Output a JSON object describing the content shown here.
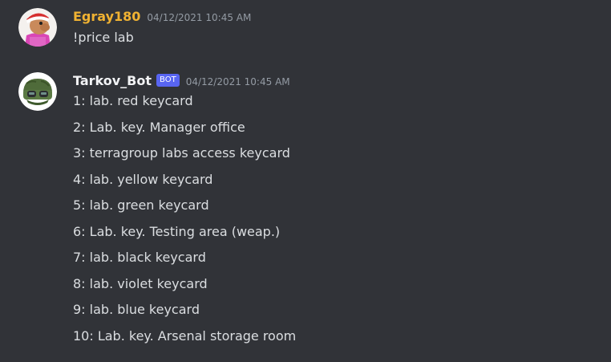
{
  "messages": [
    {
      "username": "Egray180",
      "timestamp": "04/12/2021 10:45 AM",
      "text": "!price lab",
      "avatar_icon": "cartoon-user-avatar-icon",
      "username_color": "#f0b232"
    },
    {
      "username": "Tarkov_Bot",
      "badge": "BOT",
      "timestamp": "04/12/2021 10:45 AM",
      "avatar_icon": "soldier-helmet-avatar-icon",
      "badge_color": "#5865f2",
      "lines": [
        "1: lab. red keycard",
        "2: Lab. key. Manager office",
        "3: terragroup labs access keycard",
        "4: lab. yellow keycard",
        "5: lab. green keycard",
        "6: Lab. key. Testing area (weap.)",
        "7: lab. black keycard",
        "8: lab. violet keycard",
        "9: lab. blue keycard",
        "10: Lab. key. Arsenal storage room"
      ]
    }
  ]
}
